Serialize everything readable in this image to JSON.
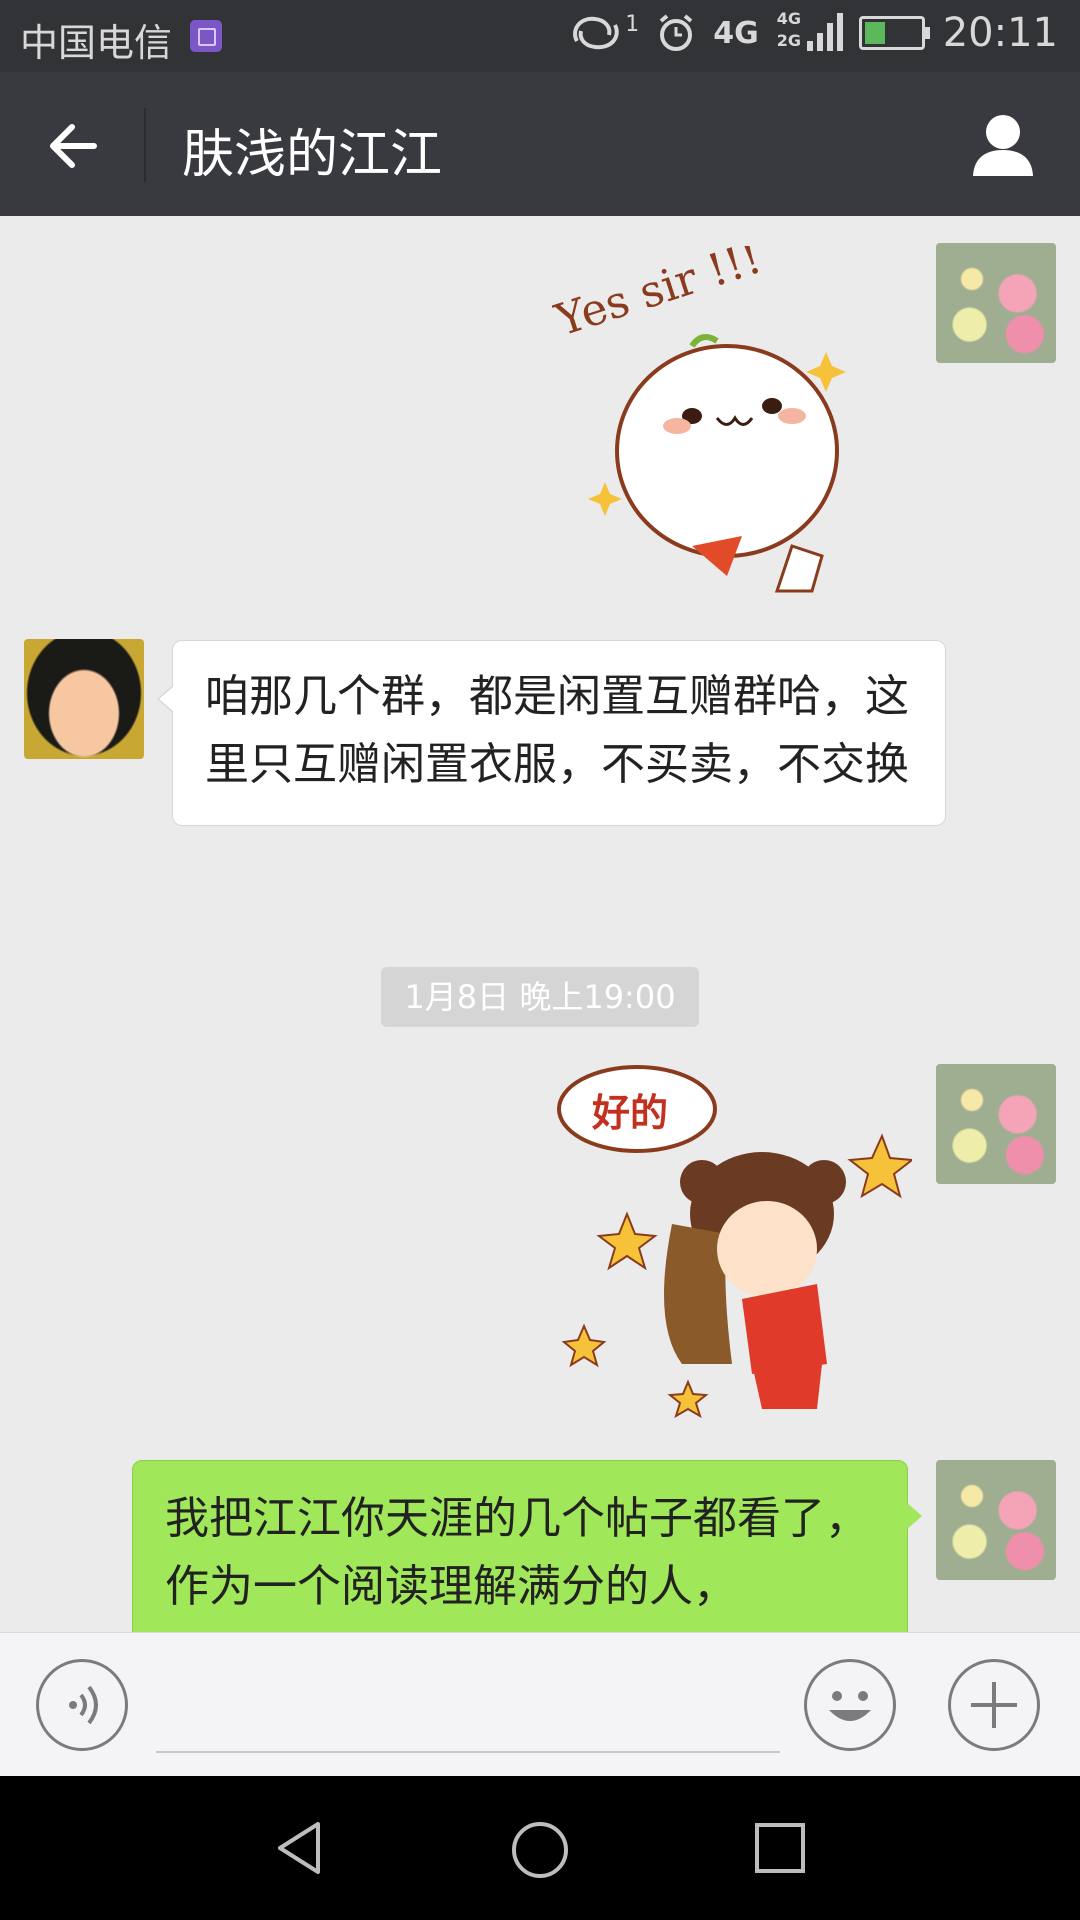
{
  "status_bar": {
    "carrier": "中国电信",
    "notification_count": "1",
    "network_top": "4G",
    "network_mini": "4G",
    "network_mini2": "2G",
    "time": "20:11",
    "icons": [
      "gallery-notification-icon",
      "sync-icon",
      "alarm-icon",
      "signal-icon",
      "battery-charging-icon"
    ]
  },
  "header": {
    "title": "肤浅的江江",
    "icons": [
      "back-arrow-icon",
      "profile-icon"
    ]
  },
  "messages": [
    {
      "type": "sticker",
      "from": "me",
      "text": "Yes sir !!!"
    },
    {
      "type": "text",
      "from": "other",
      "text": "咱那几个群，都是闲置互赠群哈，这里只互赠闲置衣服，不买卖，不交换"
    },
    {
      "type": "timestamp",
      "text": "1月8日 晚上19:00"
    },
    {
      "type": "sticker",
      "from": "me",
      "text": "好的"
    },
    {
      "type": "text",
      "from": "me",
      "text": "我把江江你天涯的几个帖子都看了，作为一个阅读理解满分的人，"
    }
  ],
  "input_bar": {
    "icons": [
      "voice-icon",
      "emoji-icon",
      "plus-icon"
    ]
  },
  "nav_bar": {
    "icons": [
      "nav-back-icon",
      "nav-home-icon",
      "nav-recents-icon"
    ]
  },
  "colors": {
    "titlebar": "#393a3f",
    "statusbar": "#323337",
    "chat_bg": "#ebebeb",
    "sent_bubble": "#a0e75a",
    "received_bubble": "#ffffff"
  }
}
